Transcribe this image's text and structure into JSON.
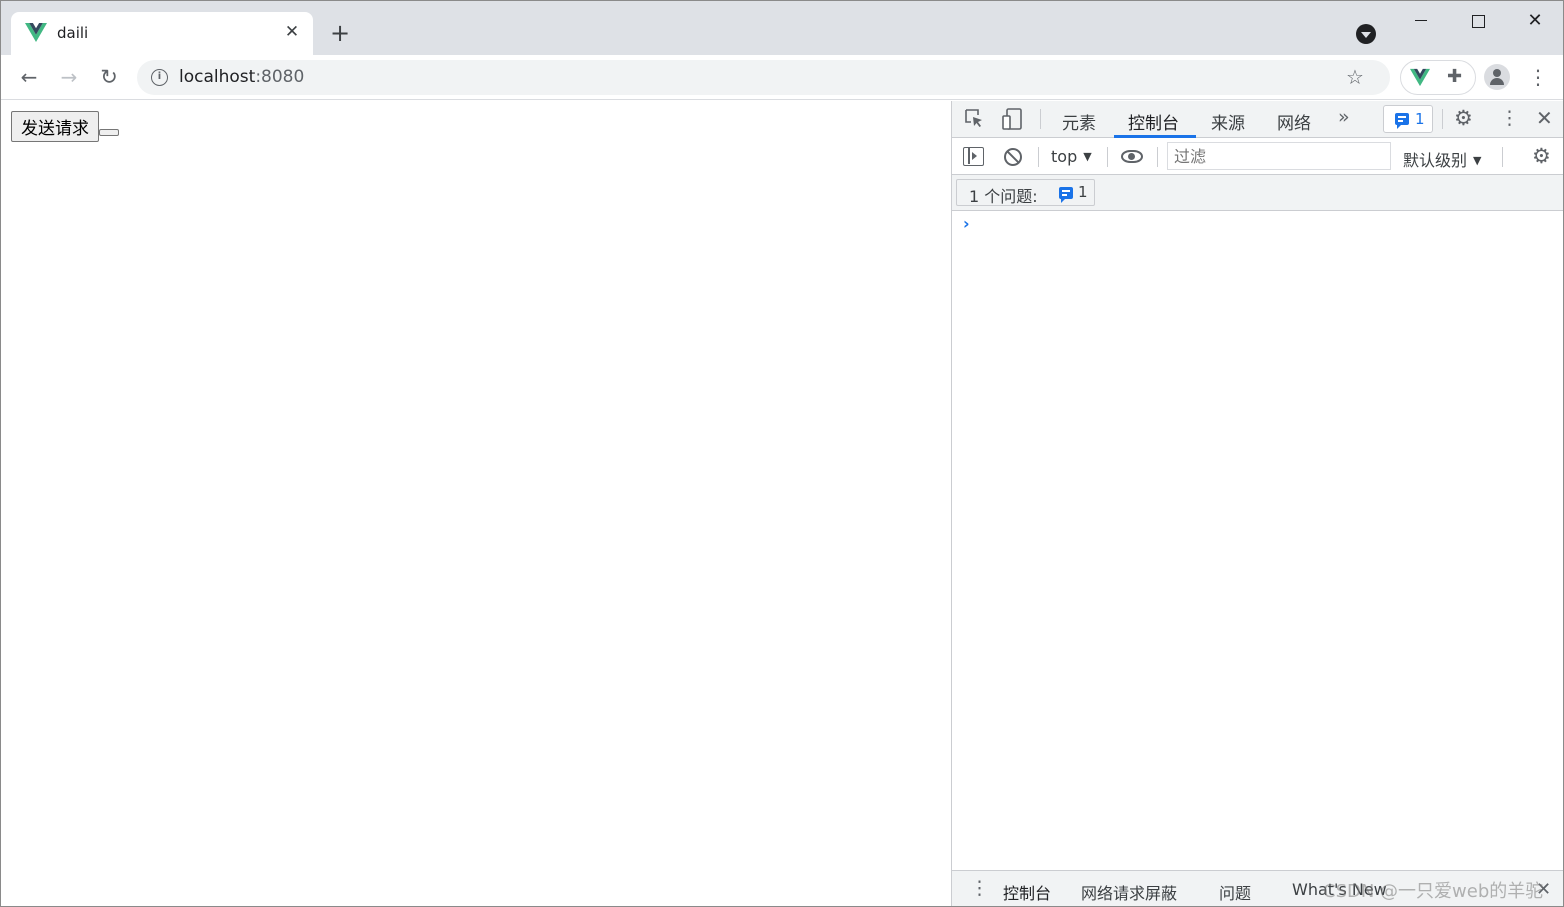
{
  "browser": {
    "tab": {
      "title": "daili",
      "close_label": "✕"
    },
    "new_tab_label": "+",
    "address_bar": {
      "host": "localhost",
      "port": ":8080"
    }
  },
  "page": {
    "send_button_label": "发送请求",
    "empty_button_label": ""
  },
  "devtools": {
    "tabs": [
      {
        "label": "元素"
      },
      {
        "label": "控制台",
        "active": true
      },
      {
        "label": "来源"
      },
      {
        "label": "网络"
      }
    ],
    "more_tabs_label": "»",
    "issue_badge_count": "1",
    "console_toolbar": {
      "context_label": "top",
      "filter_placeholder": "过滤",
      "levels_label": "默认级别"
    },
    "issues_bar": {
      "text": "1 个问题:",
      "count": "1"
    },
    "prompt": "›",
    "drawer_tabs": [
      {
        "label": "控制台",
        "active": true
      },
      {
        "label": "网络请求屏蔽"
      },
      {
        "label": "问题"
      },
      {
        "label": "What's New"
      }
    ]
  },
  "watermark": "CSDN @一只爱web的羊驼",
  "colors": {
    "accent": "#1a73e8",
    "vue_green": "#41b883",
    "vue_dark": "#34495e",
    "tabstrip": "#dee1e6"
  }
}
